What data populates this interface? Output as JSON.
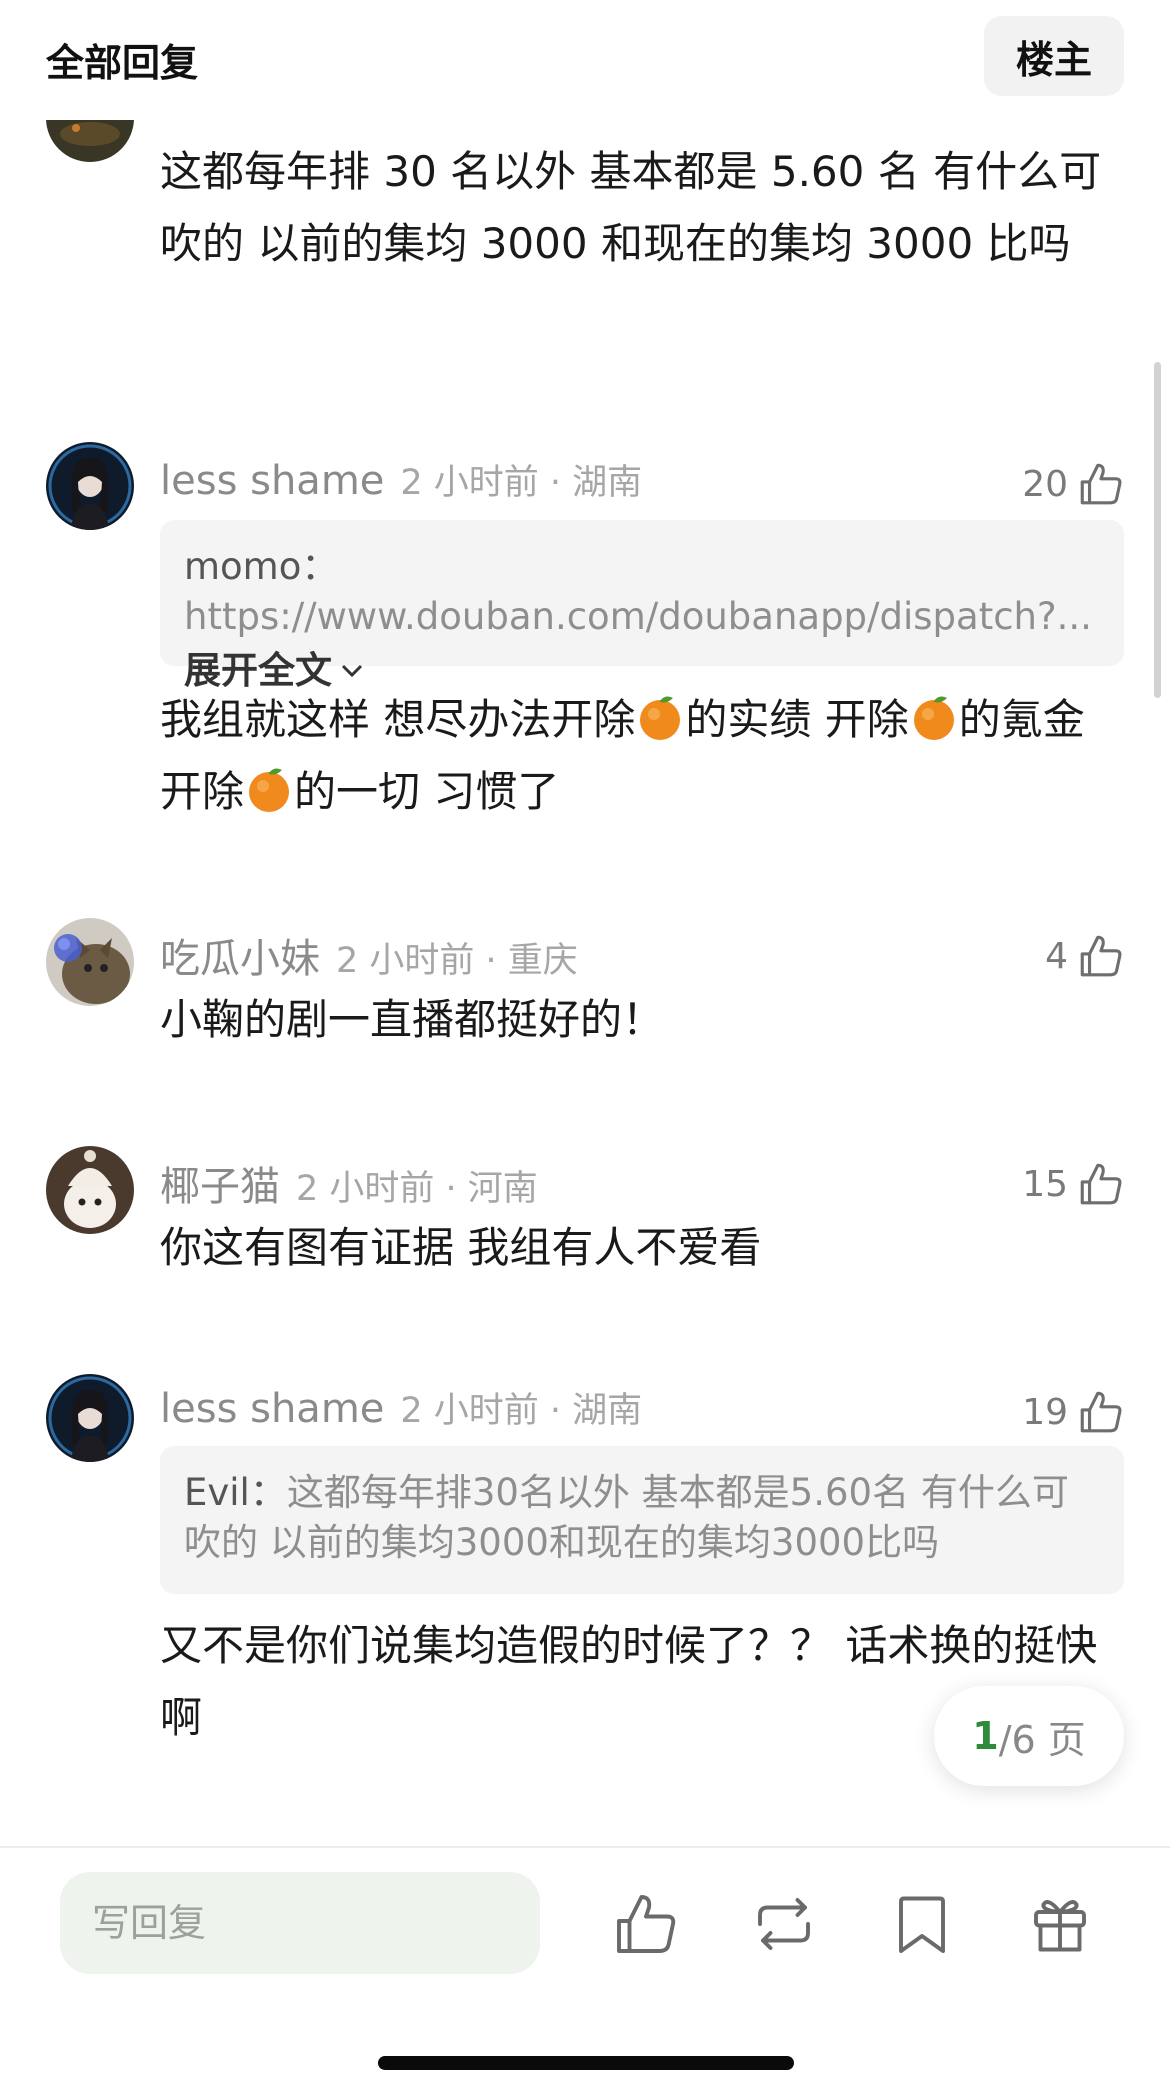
{
  "header": {
    "title": "全部回复",
    "op_button": "楼主"
  },
  "comments": [
    {
      "body": "这都每年排 30 名以外 基本都是 5.60 名 有什么可吹的 以前的集均 3000 和现在的集均 3000 比吗"
    },
    {
      "author": "less shame",
      "time_location": "2 小时前 · 湖南",
      "likes": "20",
      "quote_name": "momo：",
      "quote_text": "https://www.douban.com/doubanapp/dispatch?...",
      "quote_expand": "展开全文",
      "body_part1": "我组就这样 想尽办法开除",
      "body_part2": "的实绩  开除",
      "body_part3": "的氪金 开除",
      "body_part4": "的一切  习惯了"
    },
    {
      "author": "吃瓜小妹",
      "time_location": "2 小时前 · 重庆",
      "likes": "4",
      "body": "小鞠的剧一直播都挺好的！"
    },
    {
      "author": "椰子猫",
      "time_location": "2 小时前 · 河南",
      "likes": "15",
      "body": "你这有图有证据 我组有人不爱看"
    },
    {
      "author": "less shame",
      "time_location": "2 小时前 · 湖南",
      "likes": "19",
      "quote_name": "Evil：",
      "quote_text": "这都每年排30名以外 基本都是5.60名 有什么可吹的 以前的集均3000和现在的集均3000比吗",
      "body": "又不是你们说集均造假的时候了？？ 话术换的挺快啊"
    }
  ],
  "pager": {
    "current": "1",
    "total": "/6 页"
  },
  "bottom_bar": {
    "reply_placeholder": "写回复",
    "icons": [
      "thumbs-up-icon",
      "repost-icon",
      "bookmark-icon",
      "gift-icon"
    ]
  },
  "colors": {
    "accent": "#2e8b3a",
    "muted": "#8a8a8a",
    "quote_bg": "#f4f4f4"
  }
}
